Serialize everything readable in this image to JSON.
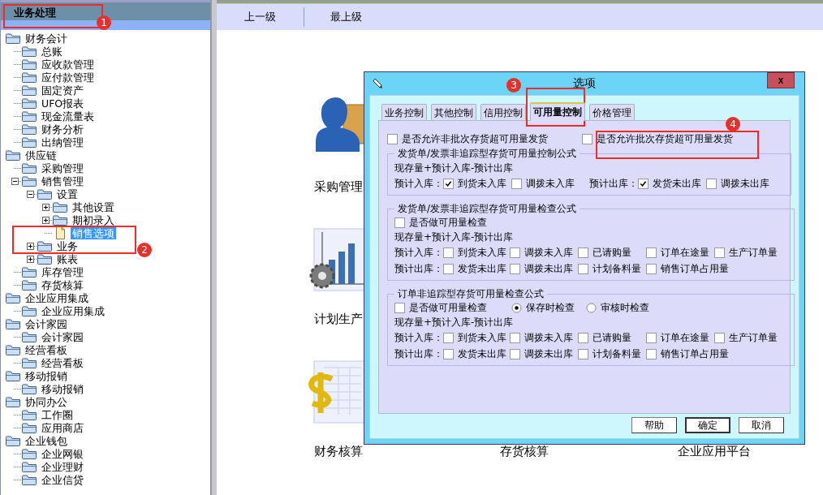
{
  "sidebar": {
    "title": "业务处理",
    "tree": [
      {
        "label": "财务会计",
        "kind": "folder",
        "selected": false,
        "children": [
          {
            "label": "总账",
            "kind": "folder",
            "selected": false
          },
          {
            "label": "应收款管理",
            "kind": "folder",
            "selected": false
          },
          {
            "label": "应付款管理",
            "kind": "folder",
            "selected": false
          },
          {
            "label": "固定资产",
            "kind": "folder",
            "selected": false
          },
          {
            "label": "UFO报表",
            "kind": "folder",
            "selected": false
          },
          {
            "label": "现金流量表",
            "kind": "folder",
            "selected": false
          },
          {
            "label": "财务分析",
            "kind": "folder",
            "selected": false
          },
          {
            "label": "出纳管理",
            "kind": "folder",
            "selected": false
          }
        ]
      },
      {
        "label": "供应链",
        "kind": "folder",
        "selected": false,
        "children": [
          {
            "label": "采购管理",
            "kind": "folder",
            "selected": false
          },
          {
            "label": "销售管理",
            "kind": "folder",
            "selected": false,
            "expanded": true,
            "children": [
              {
                "label": "设置",
                "kind": "folder",
                "selected": false,
                "expanded": true,
                "children": [
                  {
                    "label": "其他设置",
                    "kind": "folder",
                    "selected": false,
                    "expanded": false
                  },
                  {
                    "label": "期初录入",
                    "kind": "folder",
                    "selected": false,
                    "expanded": false
                  },
                  {
                    "label": "销售选项",
                    "kind": "document",
                    "selected": true
                  }
                ]
              },
              {
                "label": "业务",
                "kind": "folder",
                "selected": false,
                "expanded": false
              },
              {
                "label": "账表",
                "kind": "folder",
                "selected": false,
                "expanded": false
              }
            ]
          },
          {
            "label": "库存管理",
            "kind": "folder",
            "selected": false
          },
          {
            "label": "存货核算",
            "kind": "folder",
            "selected": false
          }
        ]
      },
      {
        "label": "企业应用集成",
        "kind": "folder",
        "selected": false,
        "children": [
          {
            "label": "企业应用集成",
            "kind": "folder",
            "selected": false
          }
        ]
      },
      {
        "label": "会计家园",
        "kind": "folder",
        "selected": false,
        "children": [
          {
            "label": "会计家园",
            "kind": "folder",
            "selected": false
          }
        ]
      },
      {
        "label": "经营看板",
        "kind": "folder",
        "selected": false,
        "children": [
          {
            "label": "经营看板",
            "kind": "folder",
            "selected": false
          }
        ]
      },
      {
        "label": "移动报销",
        "kind": "folder",
        "selected": false,
        "children": [
          {
            "label": "移动报销",
            "kind": "folder",
            "selected": false
          }
        ]
      },
      {
        "label": "协同办公",
        "kind": "folder",
        "selected": false,
        "children": [
          {
            "label": "工作圈",
            "kind": "folder",
            "selected": false
          },
          {
            "label": "应用商店",
            "kind": "folder",
            "selected": false
          }
        ]
      },
      {
        "label": "企业钱包",
        "kind": "folder",
        "selected": false,
        "children": [
          {
            "label": "企业网银",
            "kind": "folder",
            "selected": false
          },
          {
            "label": "企业理财",
            "kind": "folder",
            "selected": false
          },
          {
            "label": "企业信贷",
            "kind": "folder",
            "selected": false
          }
        ]
      }
    ]
  },
  "toolbar": [
    "上一级",
    "最上级"
  ],
  "modules": [
    {
      "label": "采购管理",
      "kind": "person"
    },
    {
      "label": "计划生产",
      "kind": "chart"
    },
    {
      "label": "财务核算",
      "kind": "dollar"
    },
    {
      "label": "存货核算"
    },
    {
      "label": "企业应用平台"
    }
  ],
  "dialog": {
    "title": "选项",
    "close": "x",
    "tabs": [
      {
        "label": "业务控制",
        "selected": false
      },
      {
        "label": "其他控制",
        "selected": false
      },
      {
        "label": "信用控制",
        "selected": false
      },
      {
        "label": "可用量控制",
        "selected": true
      },
      {
        "label": "价格管理",
        "selected": false
      }
    ],
    "top_options": [
      {
        "label": "是否允许非批次存货超可用量发货",
        "checked": false
      },
      {
        "label": "是否允许批次存货超可用量发货",
        "checked": false
      }
    ],
    "groups": [
      {
        "title": "发货单/发票非追踪型存货可用量控制公式",
        "kind": "inline",
        "formula": "现存量+预计入库-预计出库",
        "rows": [
          {
            "label": "预计入库：",
            "options": [
              {
                "label": "到货未入库",
                "checked": true
              },
              {
                "label": "调拨未入库",
                "checked": false
              }
            ]
          },
          {
            "label": "预计出库：",
            "options": [
              {
                "label": "发货未出库",
                "checked": true
              },
              {
                "label": "调拨未出库",
                "checked": false
              }
            ]
          }
        ]
      },
      {
        "title": "发货单/发票非追踪型存货可用量检查公式",
        "kind": "grid",
        "check": {
          "label": "是否做可用量检查",
          "checked": false
        },
        "formula": "现存量+预计入库-预计出库",
        "rows": [
          {
            "label": "预计入库：",
            "options": [
              {
                "label": "到货未入库",
                "checked": false
              },
              {
                "label": "调拨未入库",
                "checked": false
              },
              {
                "label": "已请购量",
                "checked": false
              },
              {
                "label": "订单在途量",
                "checked": false
              },
              {
                "label": "生产订单量",
                "checked": false
              }
            ]
          },
          {
            "label": "预计出库：",
            "options": [
              {
                "label": "发货未出库",
                "checked": false
              },
              {
                "label": "调拨未出库",
                "checked": false
              },
              {
                "label": "计划备料量",
                "checked": false
              },
              {
                "label": "销售订单占用量",
                "checked": false
              }
            ]
          }
        ]
      },
      {
        "title": "订单非追踪型存货可用量检查公式",
        "kind": "grid",
        "check": {
          "label": "是否做可用量检查",
          "checked": false
        },
        "radios": [
          {
            "label": "保存时检查",
            "selected": true
          },
          {
            "label": "审核时检查",
            "selected": false
          }
        ],
        "formula": "现存量+预计入库-预计出库",
        "rows": [
          {
            "label": "预计入库：",
            "options": [
              {
                "label": "到货未入库",
                "checked": false
              },
              {
                "label": "调拨未入库",
                "checked": false
              },
              {
                "label": "已请购量",
                "checked": false
              },
              {
                "label": "订单在途量",
                "checked": false
              },
              {
                "label": "生产订单量",
                "checked": false
              }
            ]
          },
          {
            "label": "预计出库：",
            "options": [
              {
                "label": "发货未出库",
                "checked": false
              },
              {
                "label": "调拨未出库",
                "checked": false
              },
              {
                "label": "计划备料量",
                "checked": false
              },
              {
                "label": "销售订单占用量",
                "checked": false
              }
            ]
          }
        ]
      }
    ],
    "buttons": [
      {
        "label": "帮助",
        "default": false
      },
      {
        "label": "确定",
        "default": true
      },
      {
        "label": "取消",
        "default": false
      }
    ]
  },
  "annotations": [
    {
      "number": "1"
    },
    {
      "number": "2"
    },
    {
      "number": "3"
    },
    {
      "number": "4"
    }
  ]
}
